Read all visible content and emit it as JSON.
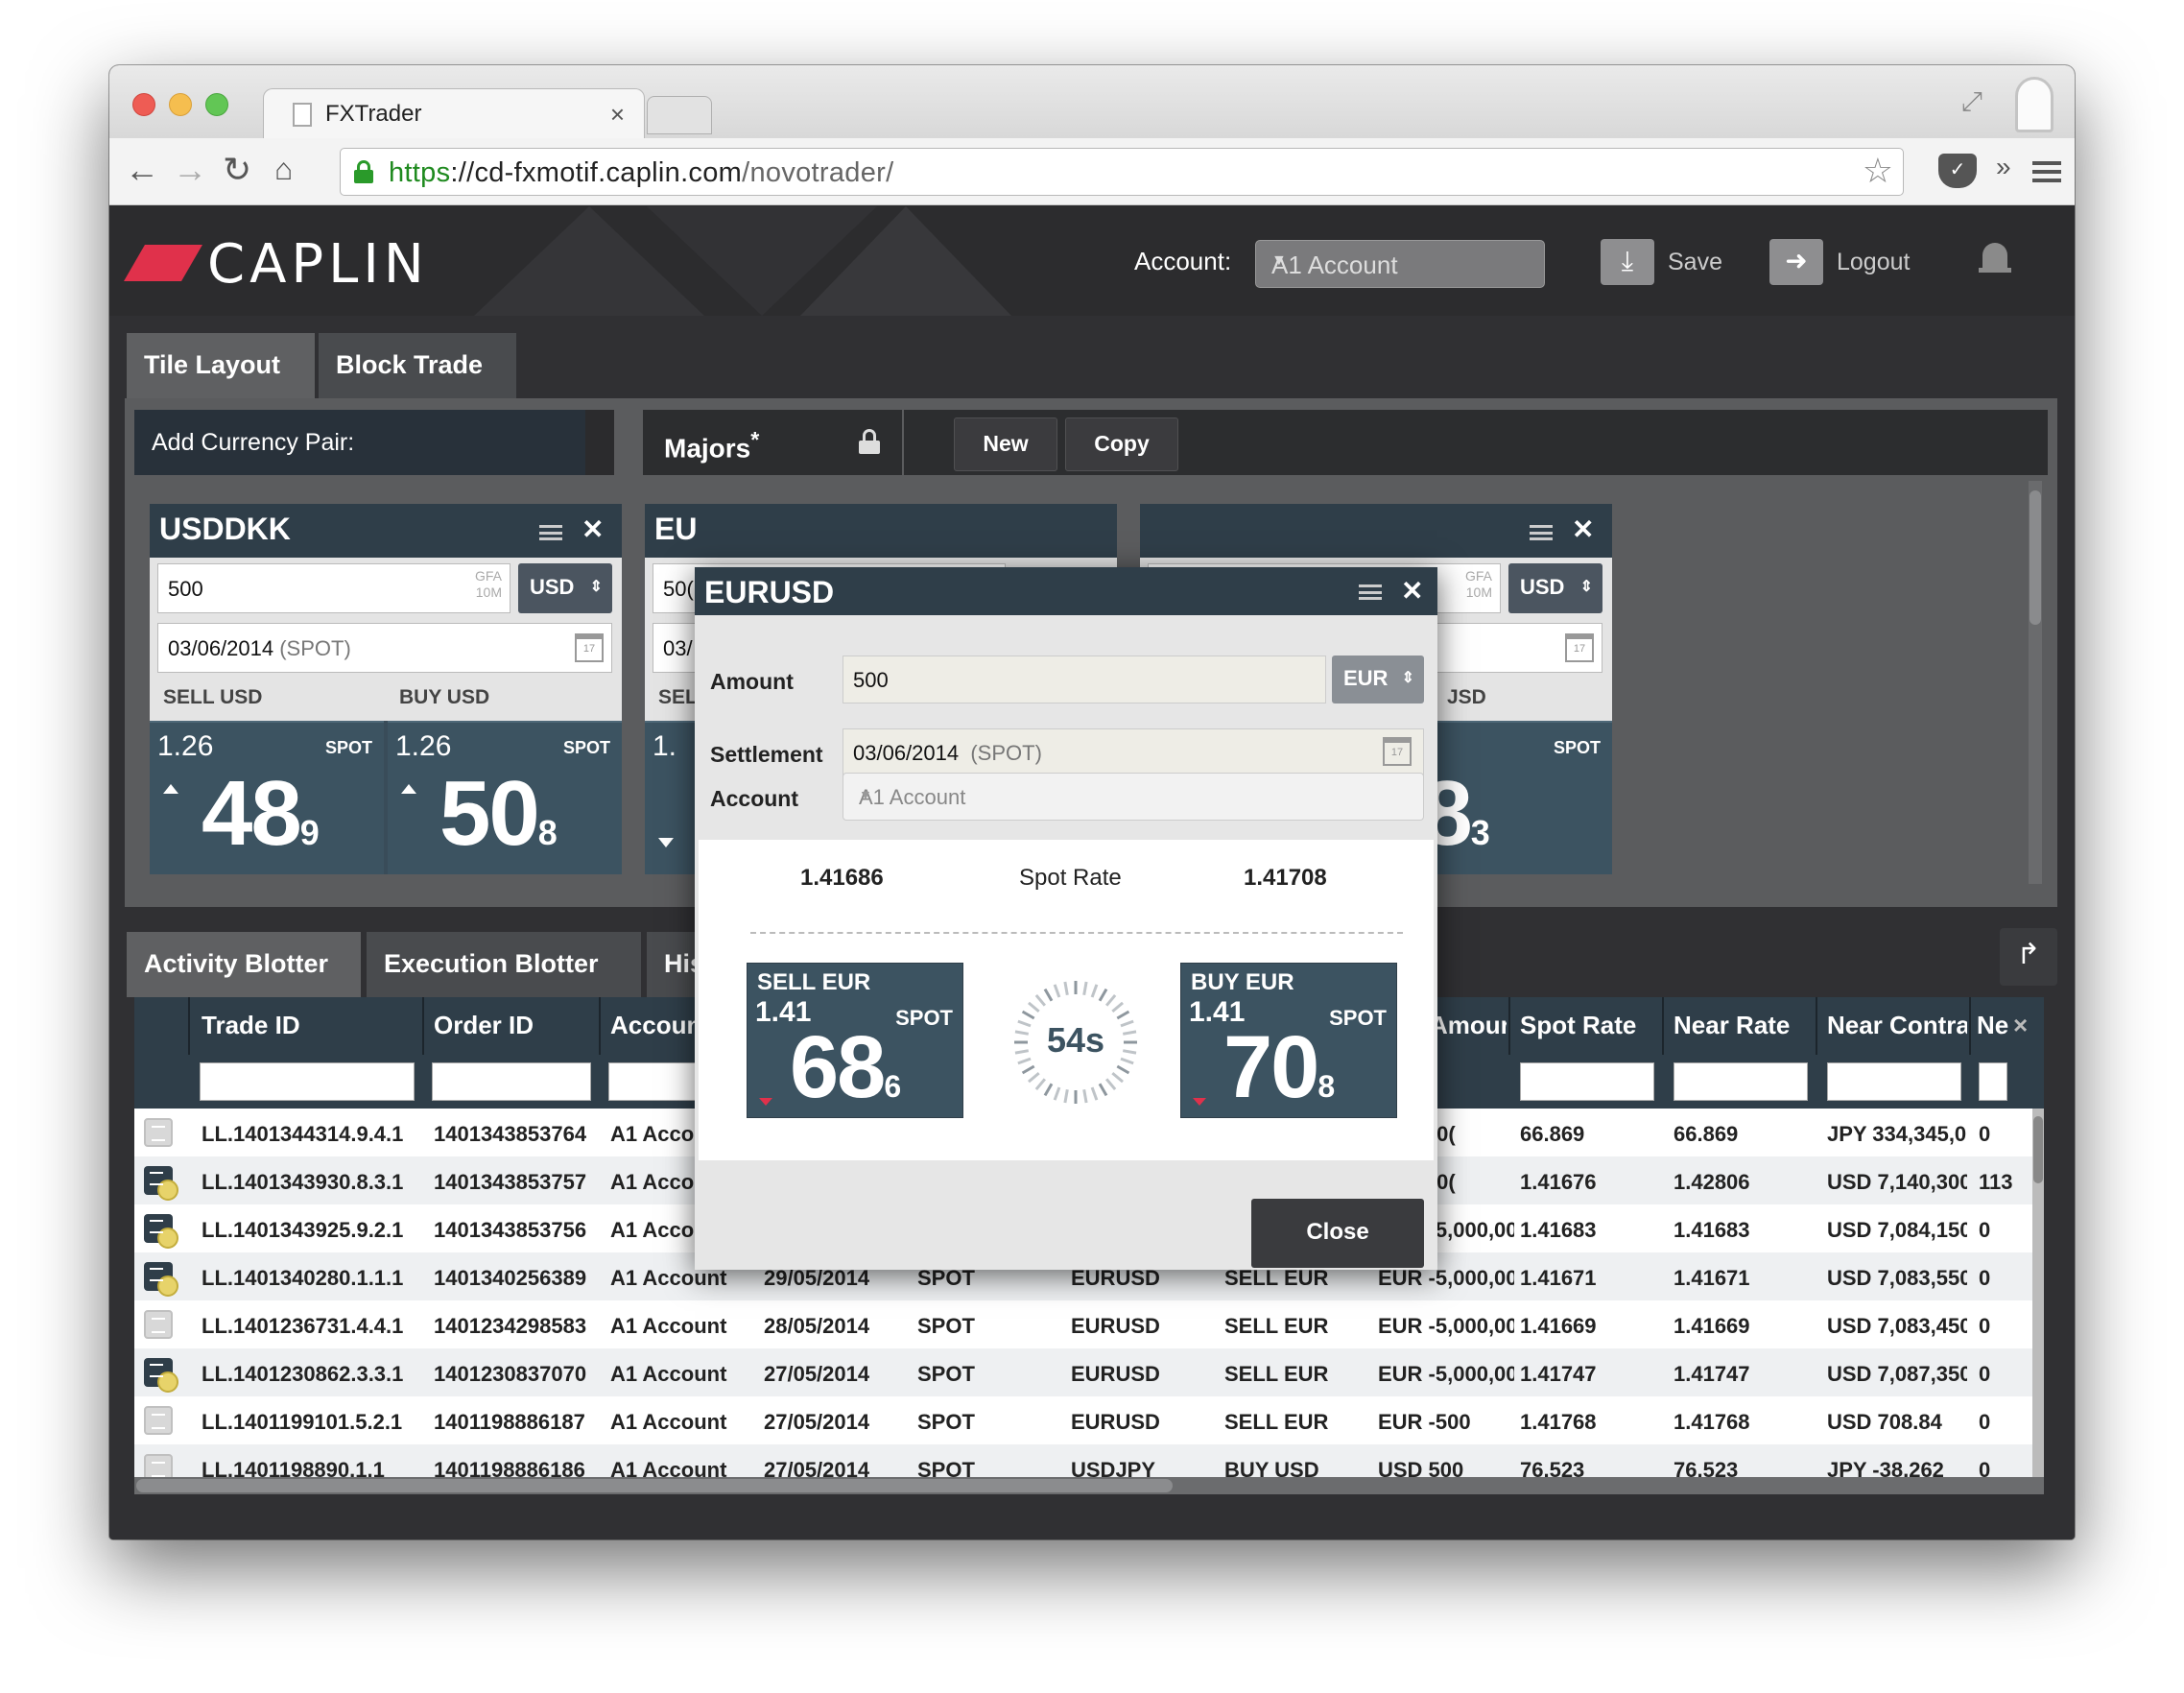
{
  "browser": {
    "tab_title": "FXTrader",
    "url_scheme": "https",
    "url_sep": "://",
    "url_host": "cd-fxmotif.caplin.com",
    "url_path": "/novotrader/"
  },
  "header": {
    "logo": "CAPLIN",
    "account_label": "Account:",
    "account_value": "A1 Account",
    "save_label": "Save",
    "logout_label": "Logout"
  },
  "layout_tabs": [
    "Tile Layout",
    "Block Trade"
  ],
  "workspace": {
    "add_pair_label": "Add Currency Pair:",
    "majors_label": "Majors",
    "majors_mark": "*",
    "new_label": "New",
    "copy_label": "Copy"
  },
  "tiles": [
    {
      "title": "USDDKK",
      "amount": "500",
      "gfa_line1": "GFA",
      "gfa_line2": "10M",
      "currency": "USD",
      "date": "03/06/2014",
      "tenor": "(SPOT)",
      "sell_label": "SELL USD",
      "buy_label": "BUY USD",
      "sell": {
        "big": "1.26",
        "spot": "SPOT",
        "pips": "48",
        "frac": "9"
      },
      "buy": {
        "big": "1.26",
        "spot": "SPOT",
        "pips": "50",
        "frac": "8"
      }
    },
    {
      "title": "EU",
      "amount": "50(",
      "date": "03/",
      "sell_label": "SEL",
      "sell": {
        "big": "1."
      }
    },
    {
      "gfa_line1": "GFA",
      "gfa_line2": "10M",
      "currency": "USD",
      "buy_label": "JSD",
      "buy": {
        "spot": "SPOT",
        "pips": "38",
        "frac": "3"
      }
    }
  ],
  "blotter_tabs": [
    "Activity Blotter",
    "Execution Blotter",
    "His"
  ],
  "blotter": {
    "columns": [
      "Trade ID",
      "Order ID",
      "Accoun",
      "Amour",
      "Spot Rate",
      "Near Rate",
      "Near Contra",
      "Ne"
    ],
    "rows": [
      {
        "icon": "plain",
        "trade_id": "LL.1401344314.9.4.1",
        "order_id": "1401343853764",
        "account": "A1 Acco",
        "date": "",
        "tenor": "",
        "pair": "",
        "side": "",
        "amount": ",000,00(",
        "spot": "66.869",
        "near": "66.869",
        "contra": "JPY 334,345,0(",
        "ne": "0"
      },
      {
        "icon": "busy",
        "trade_id": "LL.1401343930.8.3.1",
        "order_id": "1401343853757",
        "account": "A1 Acco",
        "date": "",
        "tenor": "",
        "pair": "",
        "side": "",
        "amount": ",000,00(",
        "spot": "1.41676",
        "near": "1.42806",
        "contra": "USD 7,140,300",
        "ne": "113"
      },
      {
        "icon": "busy",
        "trade_id": "LL.1401343925.9.2.1",
        "order_id": "1401343853756",
        "account": "A1 Account",
        "date": "29/05/2014",
        "tenor": "SPOT",
        "pair": "EURUSD",
        "side": "SELL EUR",
        "amount": "EUR -5,000,00(",
        "spot": "1.41683",
        "near": "1.41683",
        "contra": "USD 7,084,150",
        "ne": "0"
      },
      {
        "icon": "busy",
        "trade_id": "LL.1401340280.1.1.1",
        "order_id": "1401340256389",
        "account": "A1 Account",
        "date": "29/05/2014",
        "tenor": "SPOT",
        "pair": "EURUSD",
        "side": "SELL EUR",
        "amount": "EUR -5,000,00(",
        "spot": "1.41671",
        "near": "1.41671",
        "contra": "USD 7,083,550",
        "ne": "0"
      },
      {
        "icon": "plain",
        "trade_id": "LL.1401236731.4.4.1",
        "order_id": "1401234298583",
        "account": "A1 Account",
        "date": "28/05/2014",
        "tenor": "SPOT",
        "pair": "EURUSD",
        "side": "SELL EUR",
        "amount": "EUR -5,000,00(",
        "spot": "1.41669",
        "near": "1.41669",
        "contra": "USD 7,083,450",
        "ne": "0"
      },
      {
        "icon": "busy",
        "trade_id": "LL.1401230862.3.3.1",
        "order_id": "1401230837070",
        "account": "A1 Account",
        "date": "27/05/2014",
        "tenor": "SPOT",
        "pair": "EURUSD",
        "side": "SELL EUR",
        "amount": "EUR -5,000,00(",
        "spot": "1.41747",
        "near": "1.41747",
        "contra": "USD 7,087,350",
        "ne": "0"
      },
      {
        "icon": "plain",
        "trade_id": "LL.1401199101.5.2.1",
        "order_id": "1401198886187",
        "account": "A1 Account",
        "date": "27/05/2014",
        "tenor": "SPOT",
        "pair": "EURUSD",
        "side": "SELL EUR",
        "amount": "EUR -500",
        "spot": "1.41768",
        "near": "1.41768",
        "contra": "USD 708.84",
        "ne": "0"
      },
      {
        "icon": "plain",
        "trade_id": "LL.1401198890.1.1",
        "order_id": "1401198886186",
        "account": "A1 Account",
        "date": "27/05/2014",
        "tenor": "SPOT",
        "pair": "USDJPY",
        "side": "BUY USD",
        "amount": "USD 500",
        "spot": "76.523",
        "near": "76.523",
        "contra": "JPY -38,262",
        "ne": "0"
      }
    ]
  },
  "modal": {
    "title": "EURUSD",
    "amount_label": "Amount",
    "amount_value": "500",
    "amount_ccy": "EUR",
    "settlement_label": "Settlement",
    "settlement_date": "03/06/2014",
    "settlement_tenor": "(SPOT)",
    "account_label": "Account",
    "account_value": "A1 Account",
    "bid_rate": "1.41686",
    "rate_label": "Spot Rate",
    "ask_rate": "1.41708",
    "sell": {
      "label": "SELL EUR",
      "big": "1.41",
      "spot": "SPOT",
      "pips": "68",
      "frac": "6"
    },
    "buy": {
      "label": "BUY EUR",
      "big": "1.41",
      "spot": "SPOT",
      "pips": "70",
      "frac": "8"
    },
    "timer": "54s",
    "close_label": "Close"
  },
  "colors": {
    "accent": "#e0314b",
    "tile_head": "#2f3e49",
    "price_bg": "#3c5361",
    "url_green": "#1f8a1f"
  }
}
